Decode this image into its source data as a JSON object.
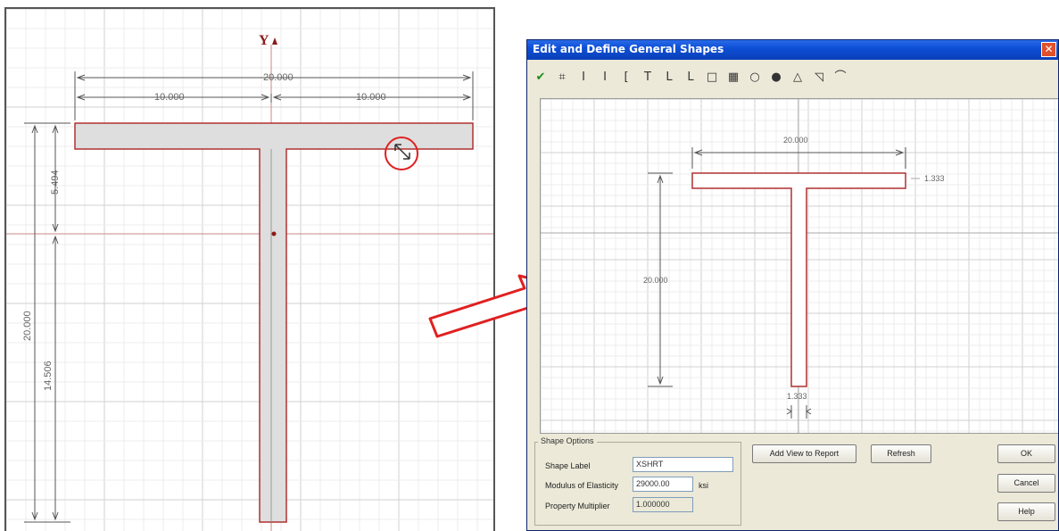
{
  "left_drawing": {
    "axis_label": "Y",
    "dim_total_width": "20.000",
    "dim_left_half": "10.000",
    "dim_right_half": "10.000",
    "dim_top_to_centroid": "5.494",
    "dim_total_height": "20.000",
    "dim_centroid_to_bottom": "14.506"
  },
  "dialog": {
    "title": "Edit and Define General Shapes",
    "close_glyph": "✕",
    "toolbar_icons": [
      "check-icon",
      "edit-shape-icon",
      "i-beam-icon",
      "wide-i-icon",
      "channel-icon",
      "tee-icon",
      "angle-icon",
      "double-angle-icon",
      "rect-tube-icon",
      "solid-rect-icon",
      "pipe-icon",
      "solid-circle-icon",
      "triangle-icon",
      "quarter-arc-icon",
      "arc-icon"
    ],
    "toolbar_glyphs": [
      "✔",
      "⌗",
      "I",
      "I",
      "[",
      "T",
      "L",
      "L",
      "□",
      "▦",
      "○",
      "●",
      "△",
      "◹",
      "⌒"
    ],
    "canvas": {
      "dim_width": "20.000",
      "dim_flange_thickness": "1.333",
      "dim_height": "20.000",
      "dim_web_thickness": "1.333"
    },
    "shape_options": {
      "legend": "Shape Options",
      "shape_label_caption": "Shape Label",
      "shape_label_value": "XSHRT",
      "modulus_caption": "Modulus of Elasticity",
      "modulus_value": "29000.00",
      "modulus_unit": "ksi",
      "multiplier_caption": "Property Multiplier",
      "multiplier_value": "1.000000"
    },
    "buttons": {
      "add_view": "Add View to Report",
      "refresh": "Refresh",
      "ok": "OK",
      "cancel": "Cancel",
      "help": "Help"
    }
  },
  "colors": {
    "shape_outline": "#b03030",
    "shape_fill": "#dedede",
    "title_bar": "#0d4fd6",
    "arrow": "#e02020"
  }
}
